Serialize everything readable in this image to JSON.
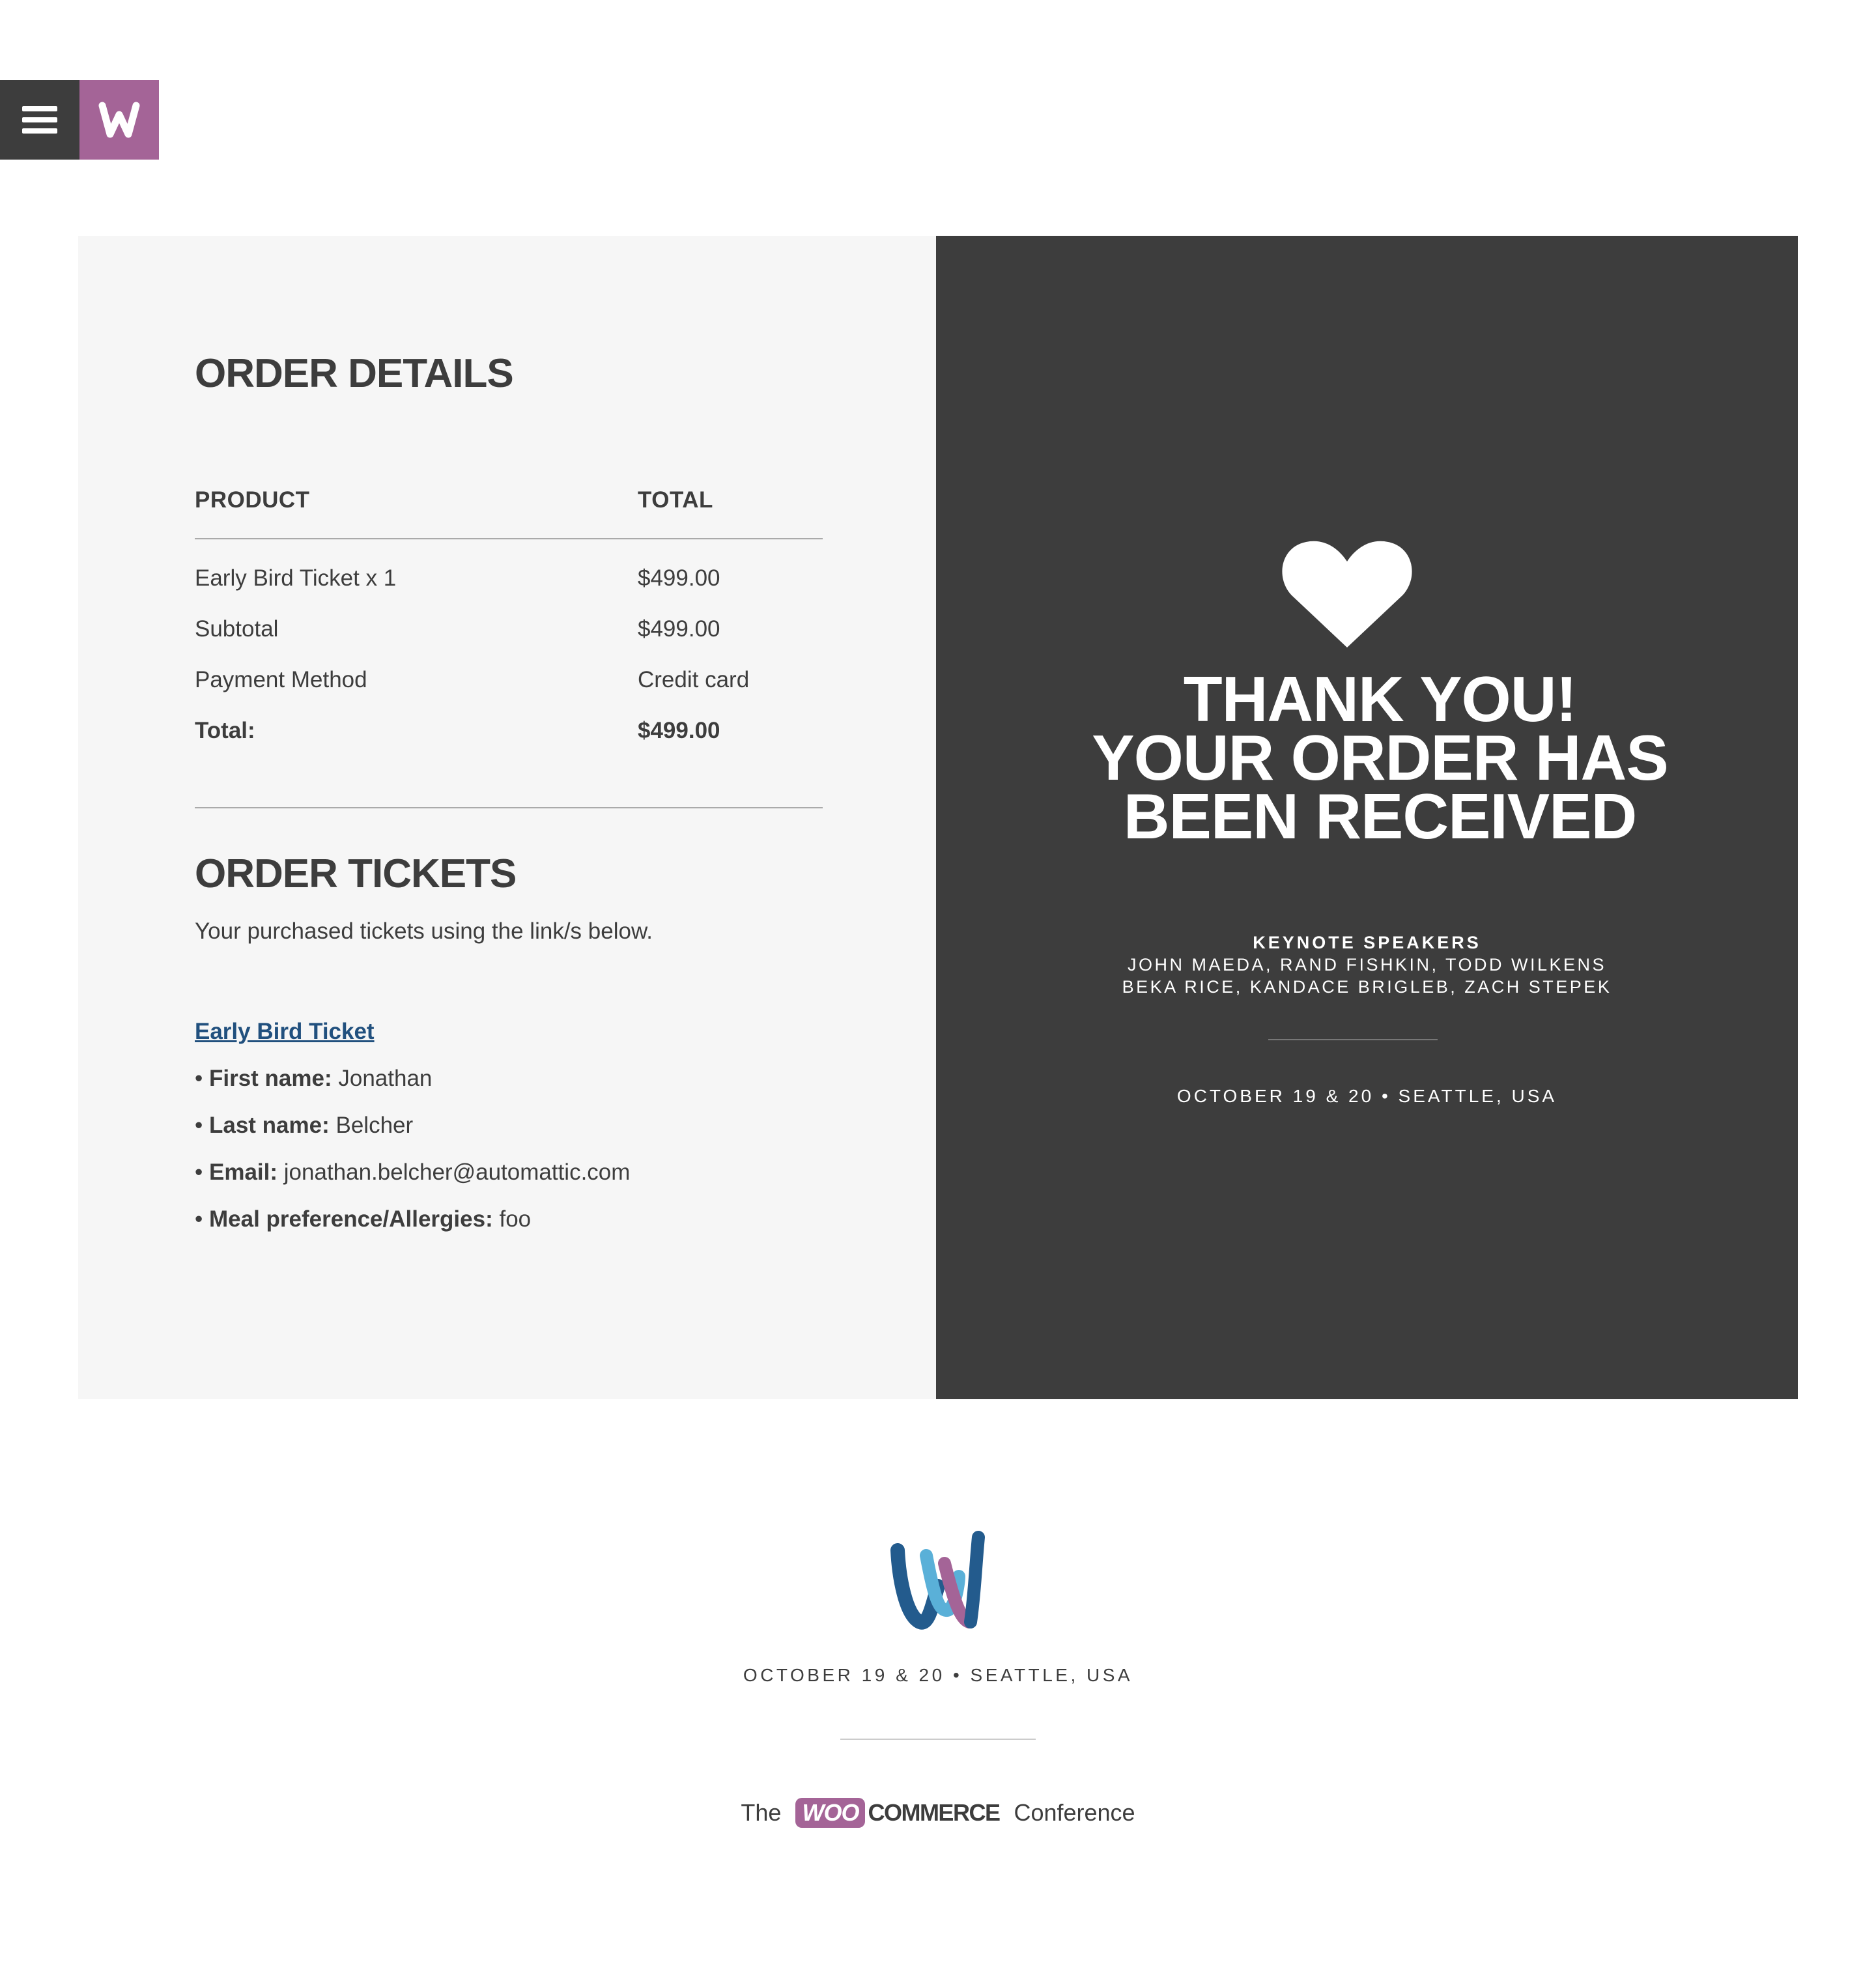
{
  "header": {
    "menu_icon": "hamburger-menu-icon",
    "logo_icon": "woo-w-logo-icon",
    "accent_dark": "#3d3d3d",
    "accent_purple": "#a46497"
  },
  "order_details": {
    "title": "ORDER DETAILS",
    "columns": [
      "PRODUCT",
      "TOTAL"
    ],
    "rows": [
      {
        "label": "Early Bird Ticket x 1",
        "value": "$499.00"
      },
      {
        "label": "Subtotal",
        "value": "$499.00"
      },
      {
        "label": "Payment Method",
        "value": "Credit card"
      },
      {
        "label": "Total:",
        "value": "$499.00"
      }
    ]
  },
  "order_tickets": {
    "title": "ORDER TICKETS",
    "description": "Your purchased tickets using the link/s below.",
    "ticket_link": "Early Bird Ticket",
    "attributes": [
      {
        "label": "First name:",
        "value": "Jonathan"
      },
      {
        "label": "Last name:",
        "value": "Belcher"
      },
      {
        "label": "Email:",
        "value": "jonathan.belcher@automattic.com"
      },
      {
        "label": "Meal preference/Allergies:",
        "value": "foo"
      }
    ]
  },
  "thank_you": {
    "heart_icon": "heart-icon",
    "lines": [
      "THANK YOU!",
      "YOUR ORDER HAS",
      "BEEN RECEIVED"
    ],
    "keynote_title": "KEYNOTE SPEAKERS",
    "speakers": [
      "JOHN MAEDA, RAND FISHKIN, TODD WILKENS",
      "BEKA RICE, KANDACE BRIGLEB, ZACH STEPEK"
    ],
    "date": "OCTOBER 19 & 20 • SEATTLE, USA"
  },
  "footer": {
    "logo_icon": "woo-conference-w-logo-icon",
    "date": "OCTOBER 19 & 20 • SEATTLE, USA",
    "prefix": "The",
    "woo": "WOO",
    "commerce": "COMMERCE",
    "suffix": "Conference"
  }
}
